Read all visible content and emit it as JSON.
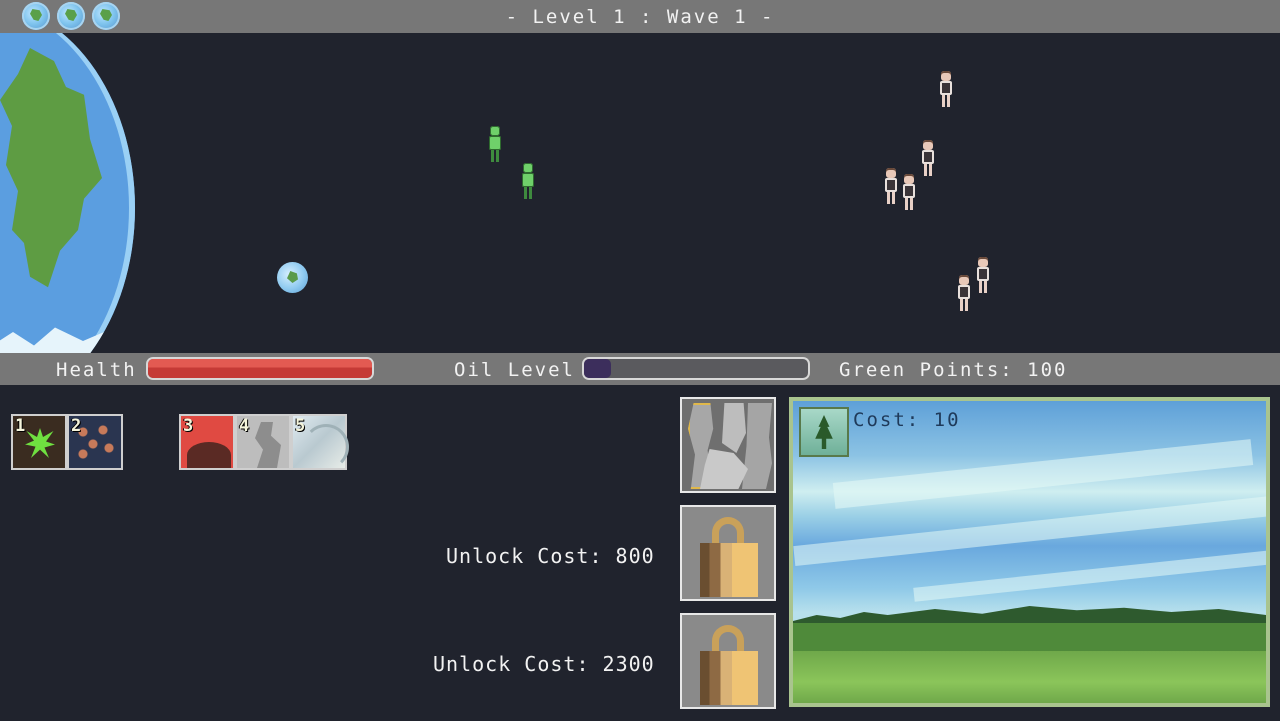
{
  "header": {
    "level_title": "-  Level 1 : Wave 1  -",
    "lives": [
      "life-icon",
      "life-icon",
      "life-icon"
    ]
  },
  "field": {
    "heroes": 2,
    "enemies": 6
  },
  "status": {
    "health_label": "Health",
    "health_fraction": 1.0,
    "oil_label": "Oil Level",
    "oil_fraction": 0.12,
    "green_points_label": "Green Points: 100",
    "colors": {
      "health": "#d8463f",
      "oil": "#3c2e5c"
    }
  },
  "abilities": {
    "slots": [
      {
        "number": "1",
        "icon": "virus-icon"
      },
      {
        "number": "2",
        "icon": "worms-icon"
      },
      {
        "number": "3",
        "icon": "lava-icon"
      },
      {
        "number": "4",
        "icon": "rock-icon"
      },
      {
        "number": "5",
        "icon": "tornado-icon"
      }
    ]
  },
  "unlocks": [
    {
      "label": "Unlock Cost: 800",
      "icon": "lock-icon"
    },
    {
      "label": "Unlock Cost: 2300",
      "icon": "lock-icon"
    }
  ],
  "preview": {
    "cost_label": "Cost: 10",
    "icon": "tree-icon"
  }
}
